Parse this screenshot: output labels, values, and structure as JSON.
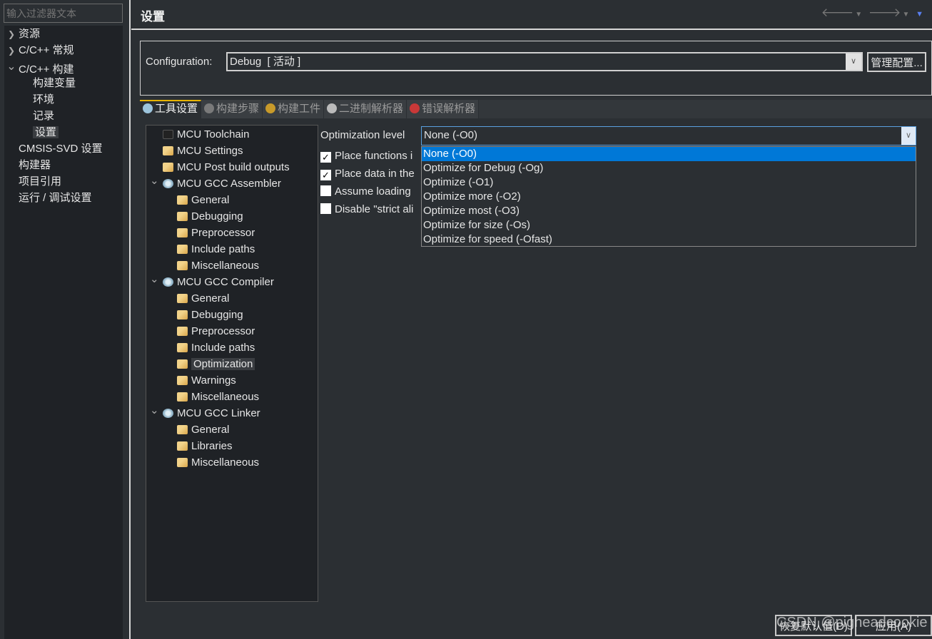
{
  "filter": {
    "placeholder": "输入过滤器文本"
  },
  "nav": [
    {
      "label": "资源",
      "level": 0,
      "chev": "right"
    },
    {
      "label": "C/C++ 常规",
      "level": 0,
      "chev": "right"
    },
    {
      "label": "C/C++ 构建",
      "level": 0,
      "chev": "down"
    },
    {
      "label": "构建变量",
      "level": 1
    },
    {
      "label": "环境",
      "level": 1
    },
    {
      "label": "记录",
      "level": 1
    },
    {
      "label": "设置",
      "level": 1,
      "selected": true
    },
    {
      "label": "CMSIS-SVD 设置",
      "level": 0
    },
    {
      "label": "构建器",
      "level": 0
    },
    {
      "label": "项目引用",
      "level": 0
    },
    {
      "label": "运行 / 调试设置",
      "level": 0
    }
  ],
  "header": {
    "title": "设置",
    "nav_icons": [
      "back-arrow-icon",
      "dropdown-icon",
      "forward-arrow-icon",
      "dropdown-icon",
      "view-menu-icon"
    ]
  },
  "configuration": {
    "label": "Configuration:",
    "value": "Debug  [ 活动 ]",
    "manage_button": "管理配置..."
  },
  "tabs": [
    {
      "label": "工具设置",
      "icon": "tool-settings-icon",
      "active": true,
      "color": "#9cc4dc"
    },
    {
      "label": "构建步骤",
      "icon": "build-steps-icon",
      "color": "#7a7a7a"
    },
    {
      "label": "构建工件",
      "icon": "trophy-icon",
      "color": "#c89a2a"
    },
    {
      "label": "二进制解析器",
      "icon": "binary-parser-icon",
      "color": "#bbbbbb"
    },
    {
      "label": "错误解析器",
      "icon": "error-parser-icon",
      "color": "#c83838"
    }
  ],
  "tree": [
    {
      "label": "MCU Toolchain",
      "level": 0,
      "icon": "chip"
    },
    {
      "label": "MCU Settings",
      "level": 0,
      "icon": "fold"
    },
    {
      "label": "MCU Post build outputs",
      "level": 0,
      "icon": "fold"
    },
    {
      "label": "MCU GCC Assembler",
      "level": 0,
      "icon": "gear",
      "expanded": true
    },
    {
      "label": "General",
      "level": 1,
      "icon": "fold"
    },
    {
      "label": "Debugging",
      "level": 1,
      "icon": "fold"
    },
    {
      "label": "Preprocessor",
      "level": 1,
      "icon": "fold"
    },
    {
      "label": "Include paths",
      "level": 1,
      "icon": "fold"
    },
    {
      "label": "Miscellaneous",
      "level": 1,
      "icon": "fold"
    },
    {
      "label": "MCU GCC Compiler",
      "level": 0,
      "icon": "gear",
      "expanded": true
    },
    {
      "label": "General",
      "level": 1,
      "icon": "fold"
    },
    {
      "label": "Debugging",
      "level": 1,
      "icon": "fold"
    },
    {
      "label": "Preprocessor",
      "level": 1,
      "icon": "fold"
    },
    {
      "label": "Include paths",
      "level": 1,
      "icon": "fold"
    },
    {
      "label": "Optimization",
      "level": 1,
      "icon": "fold",
      "selected": true
    },
    {
      "label": "Warnings",
      "level": 1,
      "icon": "fold"
    },
    {
      "label": "Miscellaneous",
      "level": 1,
      "icon": "fold"
    },
    {
      "label": "MCU GCC Linker",
      "level": 0,
      "icon": "gear",
      "expanded": true
    },
    {
      "label": "General",
      "level": 1,
      "icon": "fold"
    },
    {
      "label": "Libraries",
      "level": 1,
      "icon": "fold"
    },
    {
      "label": "Miscellaneous",
      "level": 1,
      "icon": "fold"
    }
  ],
  "optimization": {
    "label": "Optimization level",
    "value": "None (-O0)",
    "options": [
      "None (-O0)",
      "Optimize for Debug (-Og)",
      "Optimize (-O1)",
      "Optimize more (-O2)",
      "Optimize most (-O3)",
      "Optimize for size (-Os)",
      "Optimize for speed (-Ofast)"
    ],
    "selected_index": 0,
    "checkboxes": [
      {
        "label": "Place functions i",
        "checked": true
      },
      {
        "label": "Place data in the",
        "checked": true
      },
      {
        "label": "Assume loading",
        "checked": false
      },
      {
        "label": "Disable \"strict ali",
        "checked": false
      }
    ]
  },
  "buttons": {
    "restore": "恢复默认值(D)",
    "apply": "应用(A)"
  },
  "watermark": "CSDN @pigheadcookie",
  "colors": {
    "selection": "#0078d7",
    "active_tab": "#e8b400"
  }
}
